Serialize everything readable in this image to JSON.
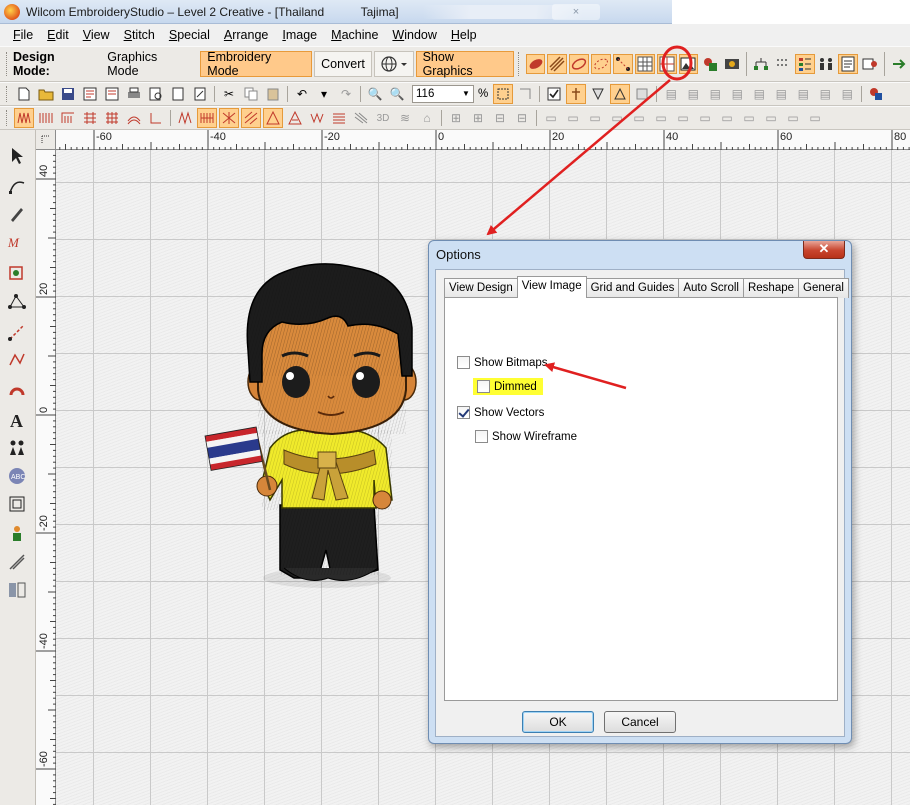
{
  "window": {
    "title": "Wilcom EmbroideryStudio – Level 2 Creative - [Thailand           Tajima]",
    "ghost_close": "×"
  },
  "menu": [
    {
      "key": "F",
      "rest": "ile"
    },
    {
      "key": "E",
      "rest": "dit"
    },
    {
      "key": "V",
      "rest": "iew"
    },
    {
      "key": "S",
      "rest": "titch"
    },
    {
      "key": "S",
      "rest": "pecial"
    },
    {
      "key": "A",
      "rest": "rrange"
    },
    {
      "key": "I",
      "rest": "mage"
    },
    {
      "key": "M",
      "rest": "achine"
    },
    {
      "key": "W",
      "rest": "indow"
    },
    {
      "key": "H",
      "rest": "elp"
    }
  ],
  "toolbar": {
    "design_mode_label": "Design Mode:",
    "graphics_mode": "Graphics Mode",
    "embroidery_mode": "Embroidery Mode",
    "convert": "Convert",
    "show_graphics": "Show Graphics",
    "zoom_value": "116",
    "zoom_unit": "%"
  },
  "rulers": {
    "top": [
      "-60",
      "-40",
      "-20",
      "0",
      "20",
      "40",
      "60",
      "80"
    ],
    "left": [
      "40",
      "20",
      "0",
      "-20",
      "-40",
      "-60"
    ]
  },
  "dialog": {
    "title": "Options",
    "close": "✕",
    "tabs": [
      "View Design",
      "View Image",
      "Grid and Guides",
      "Auto Scroll",
      "Reshape",
      "General"
    ],
    "active_tab": "View Image",
    "options": {
      "show_bitmaps": {
        "label": "Show Bitmaps",
        "checked": false
      },
      "dimmed": {
        "label": "Dimmed",
        "checked": false
      },
      "show_vectors": {
        "label": "Show Vectors",
        "checked": true
      },
      "show_wireframe": {
        "label": "Show Wireframe",
        "checked": false
      }
    },
    "ok": "OK",
    "cancel": "Cancel"
  },
  "colors": {
    "annotation_red": "#e02020",
    "highlight_yellow": "#ffff33",
    "mode_orange": "#ffc98a"
  }
}
